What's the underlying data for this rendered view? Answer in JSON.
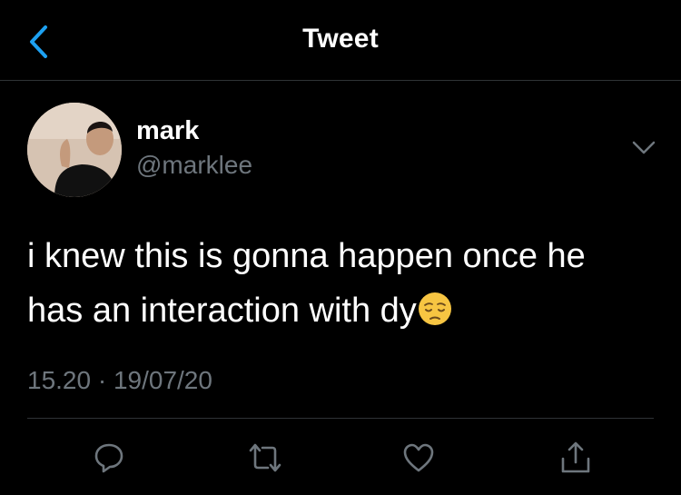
{
  "nav": {
    "title": "Tweet"
  },
  "user": {
    "name": "mark",
    "handle": "@marklee"
  },
  "tweet": {
    "line1": "i knew this is gonna happen once he",
    "line2": "has an interaction with dy",
    "emoji": "pensive-face",
    "timestamp": "15.20 · 19/07/20"
  },
  "icons": {
    "back": "chevron-left-icon",
    "more": "chevron-down-icon",
    "reply": "reply-icon",
    "retweet": "retweet-icon",
    "like": "heart-icon",
    "share": "share-icon"
  },
  "colors": {
    "accent": "#1da1f2",
    "secondary_text": "#6e767d",
    "divider": "#2f3336"
  }
}
